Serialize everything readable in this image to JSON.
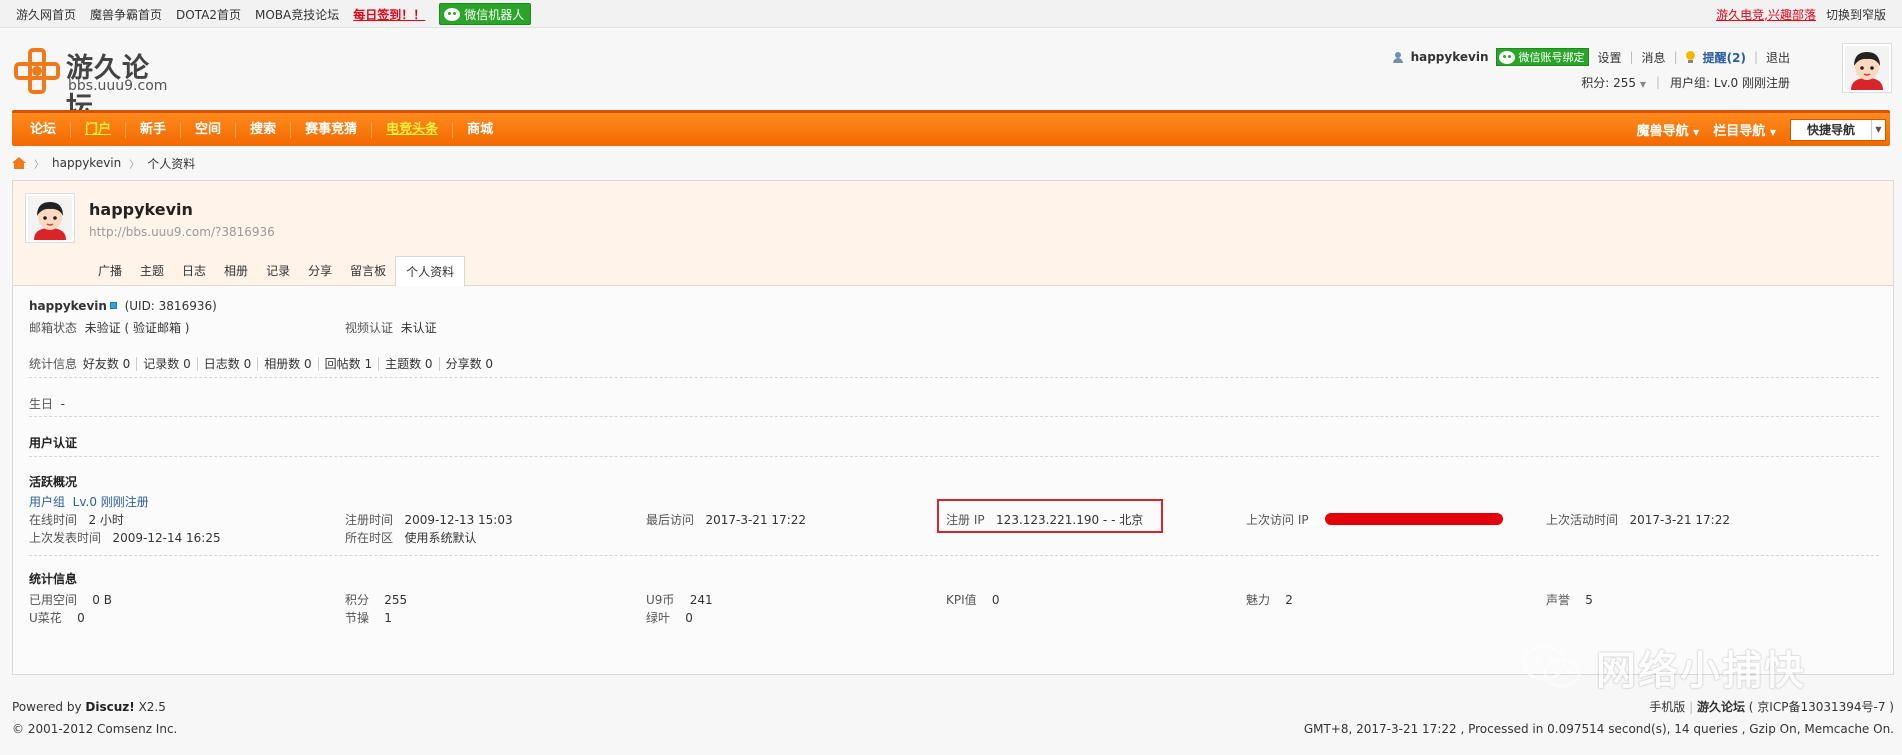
{
  "topbar": {
    "links": [
      "游久网首页",
      "魔兽争霸首页",
      "DOTA2首页",
      "MOBA竞技论坛"
    ],
    "signin": "每日签到！！",
    "wechat_robot": "微信机器人",
    "right_promo": "游久电竞,兴趣部落",
    "switch_skin": "切换到窄版"
  },
  "header": {
    "logo_title": "游久论坛",
    "logo_url": "bbs.uuu9.com",
    "username": "happykevin",
    "wechat_bind": "微信账号绑定",
    "settings": "设置",
    "messages": "消息",
    "remind": "提醒(2)",
    "logout": "退出",
    "points": "积分: 255",
    "user_group": "用户组: Lv.0 刚刚注册"
  },
  "nav": {
    "items": [
      "论坛",
      "门户",
      "新手",
      "空间",
      "搜索",
      "赛事竞猜",
      "电竞头条",
      "商城"
    ],
    "right": [
      "魔兽导航",
      "栏目导航"
    ],
    "quick": "快捷导航",
    "colors": {
      "nav_bg": "#f26a00",
      "highlight": "#ffef3a"
    }
  },
  "breadcrumb": {
    "user": "happykevin",
    "page": "个人资料"
  },
  "profile": {
    "name": "happykevin",
    "url": "http://bbs.uuu9.com/?3816936",
    "tabs": [
      "广播",
      "主题",
      "日志",
      "相册",
      "记录",
      "分享",
      "留言板",
      "个人资料"
    ],
    "uid": "(UID: 3816936)",
    "email_label": "邮箱状态",
    "email_value": "未验证 ( 验证邮箱 )",
    "video_label": "视频认证",
    "video_value": "未认证",
    "stats_label": "统计信息",
    "stats": [
      "好友数 0",
      "记录数 0",
      "日志数 0",
      "相册数 0",
      "回帖数 1",
      "主题数 0",
      "分享数 0"
    ],
    "birthday_label": "生日",
    "birthday_value": "-",
    "auth_title": "用户认证",
    "activity_title": "活跃概况",
    "group_label": "用户组",
    "group_value": "Lv.0 刚刚注册",
    "online_label": "在线时间",
    "online_value": "2 小时",
    "reg_label": "注册时间",
    "reg_value": "2009-12-13 15:03",
    "last_visit_label": "最后访问",
    "last_visit_value": "2017-3-21 17:22",
    "reg_ip_label": "注册 IP",
    "reg_ip_value": "123.123.221.190 - - 北京",
    "last_ip_label": "上次访问 IP",
    "last_active_label": "上次活动时间",
    "last_active_value": "2017-3-21 17:22",
    "last_post_label": "上次发表时间",
    "last_post_value": "2009-12-14 16:25",
    "tz_label": "所在时区",
    "tz_value": "使用系统默认",
    "stat_title": "统计信息",
    "space_label": "已用空间",
    "space_value": "0 B",
    "score_label": "积分",
    "score_value": "255",
    "u9_label": "U9币",
    "u9_value": "241",
    "kpi_label": "KPI值",
    "kpi_value": "0",
    "charm_label": "魅力",
    "charm_value": "2",
    "fame_label": "声誉",
    "fame_value": "5",
    "flower_label": "U菜花",
    "flower_value": "0",
    "jie_label": "节操",
    "jie_value": "1",
    "leaf_label": "绿叶",
    "leaf_value": "0"
  },
  "footer": {
    "powered_prefix": "Powered by",
    "powered_brand": "Discuz!",
    "powered_ver": "X2.5",
    "copyright": "© 2001-2012 Comsenz Inc.",
    "mobile": "手机版",
    "site": "游久论坛",
    "icp": "( 京ICP备13031394号-7 )",
    "stats": "GMT+8, 2017-3-21 17:22 , Processed in 0.097514 second(s), 14 queries , Gzip On, Memcache On."
  },
  "watermark": {
    "text": "网络小捕快"
  }
}
